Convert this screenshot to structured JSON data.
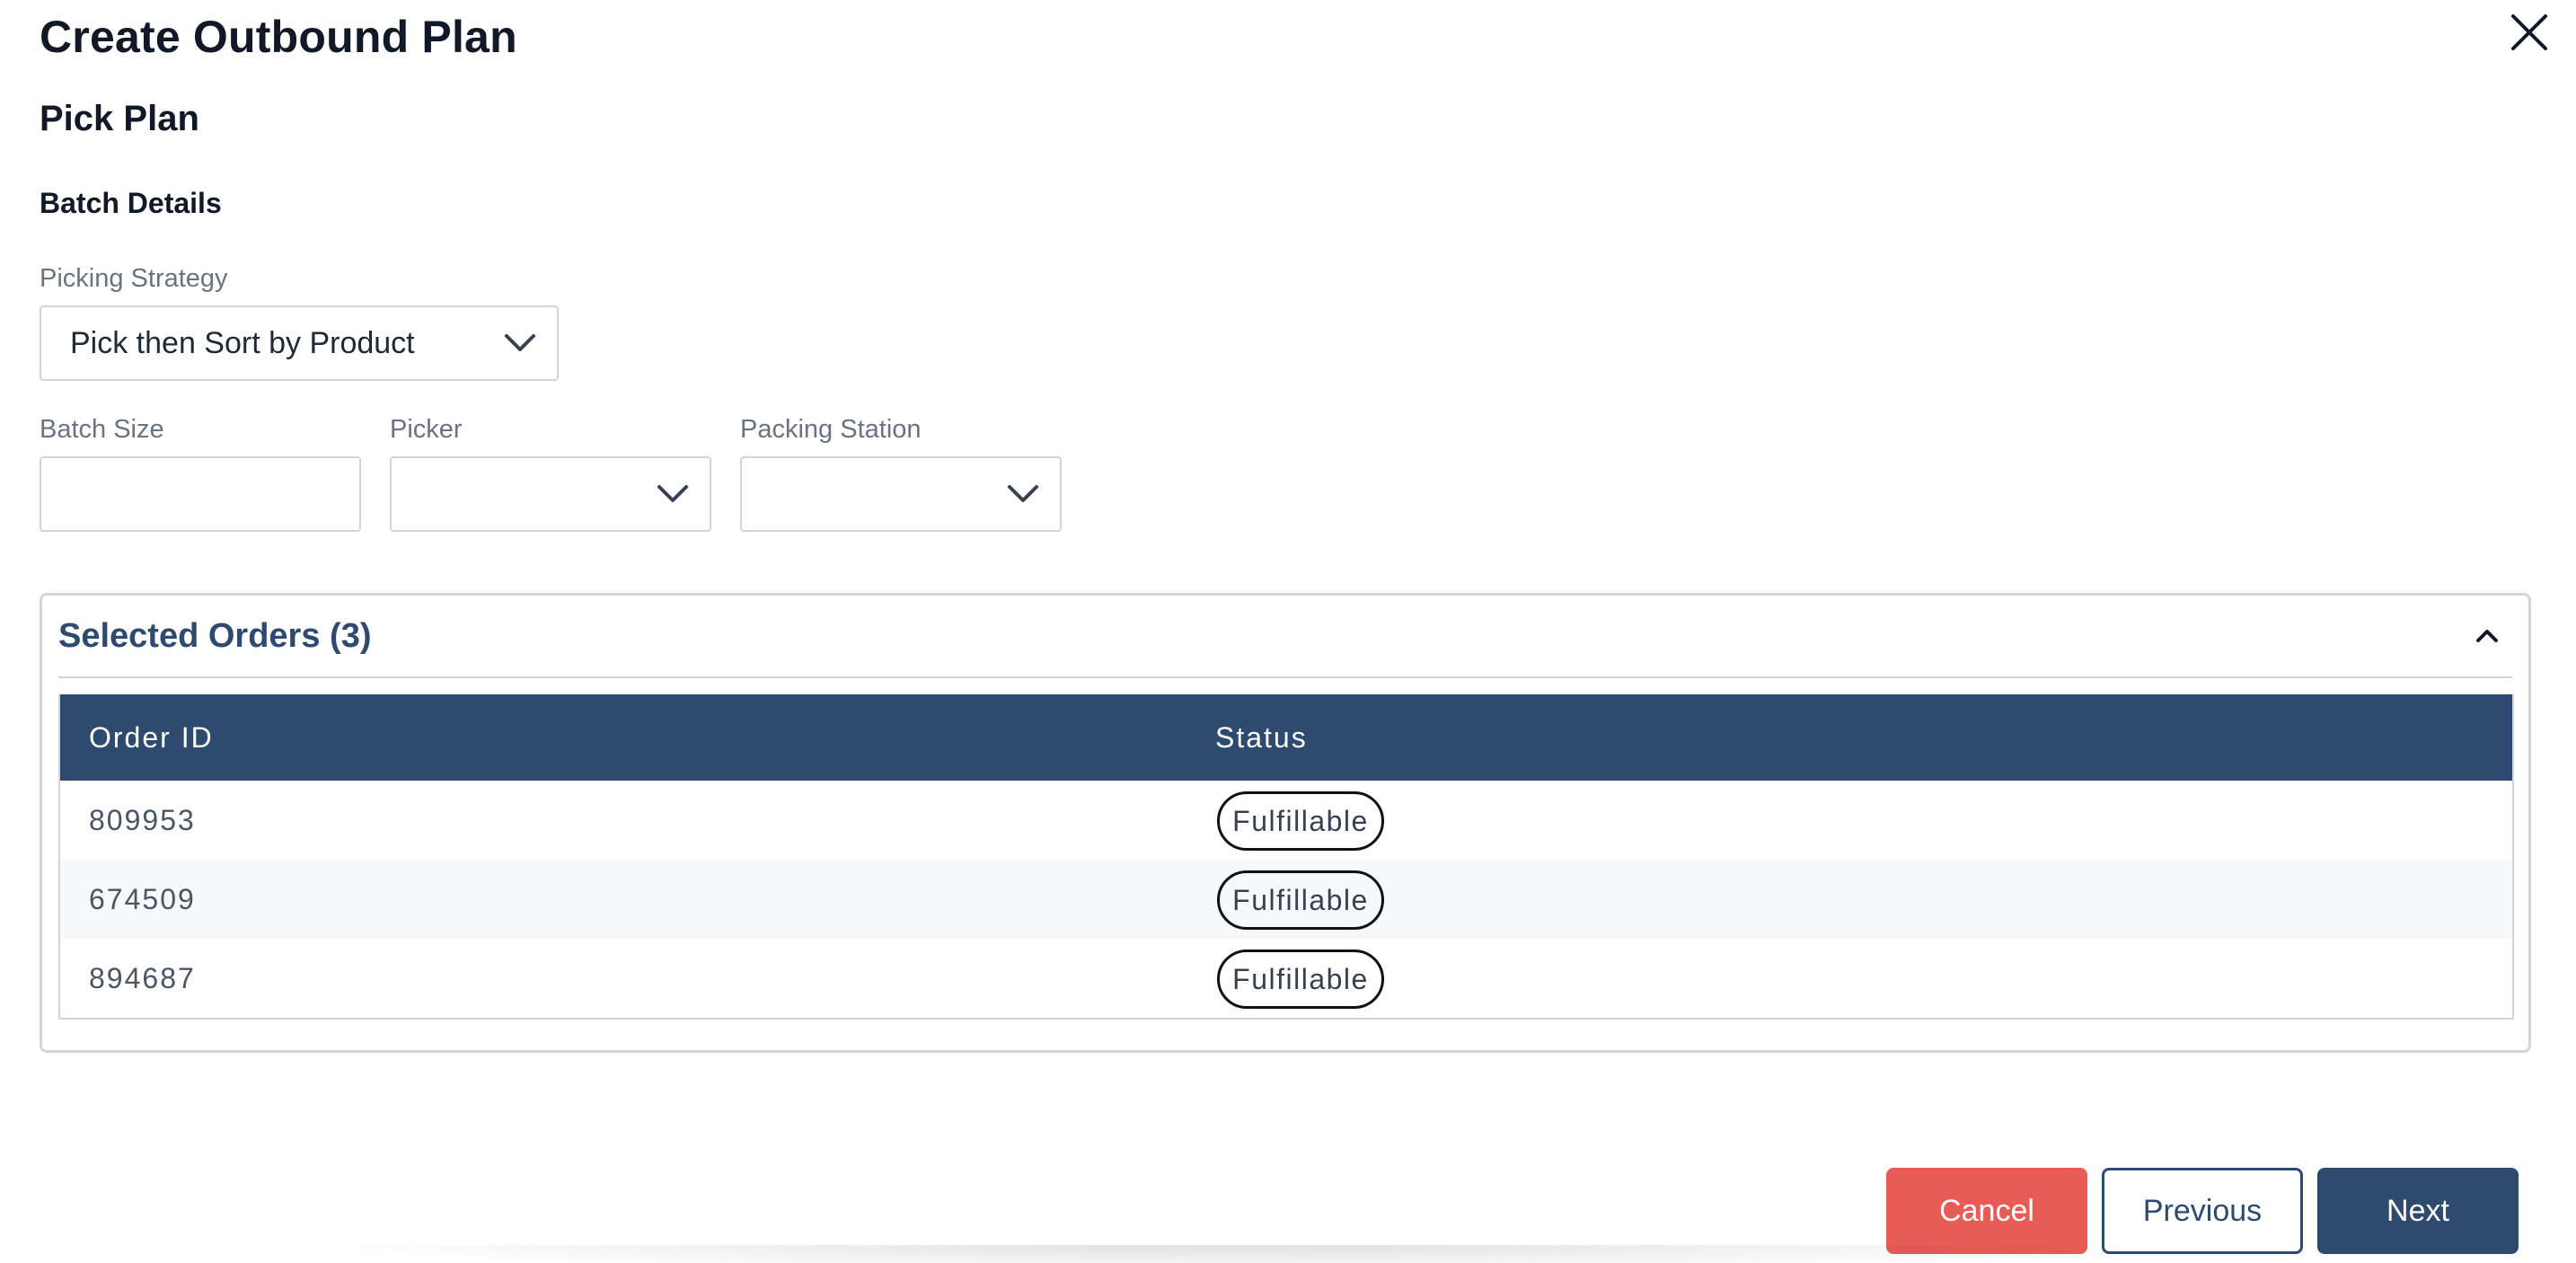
{
  "dialog": {
    "title": "Create Outbound Plan",
    "subtitle": "Pick Plan",
    "close_icon": "close-icon"
  },
  "batch_details": {
    "heading": "Batch Details",
    "picking_strategy": {
      "label": "Picking Strategy",
      "value": "Pick then Sort by Product"
    },
    "batch_size": {
      "label": "Batch Size",
      "value": ""
    },
    "picker": {
      "label": "Picker",
      "value": ""
    },
    "packing_station": {
      "label": "Packing Station",
      "value": ""
    }
  },
  "selected_orders": {
    "title": "Selected Orders (3)",
    "collapse_icon": "chevron-up-icon",
    "columns": [
      "Order ID",
      "Status"
    ],
    "rows": [
      {
        "order_id": "809953",
        "status": "Fulfillable"
      },
      {
        "order_id": "674509",
        "status": "Fulfillable"
      },
      {
        "order_id": "894687",
        "status": "Fulfillable"
      }
    ]
  },
  "footer": {
    "cancel_label": "Cancel",
    "previous_label": "Previous",
    "next_label": "Next"
  },
  "colors": {
    "primary": "#2e4a6e",
    "danger": "#e85c57",
    "border": "#d1d5db"
  }
}
